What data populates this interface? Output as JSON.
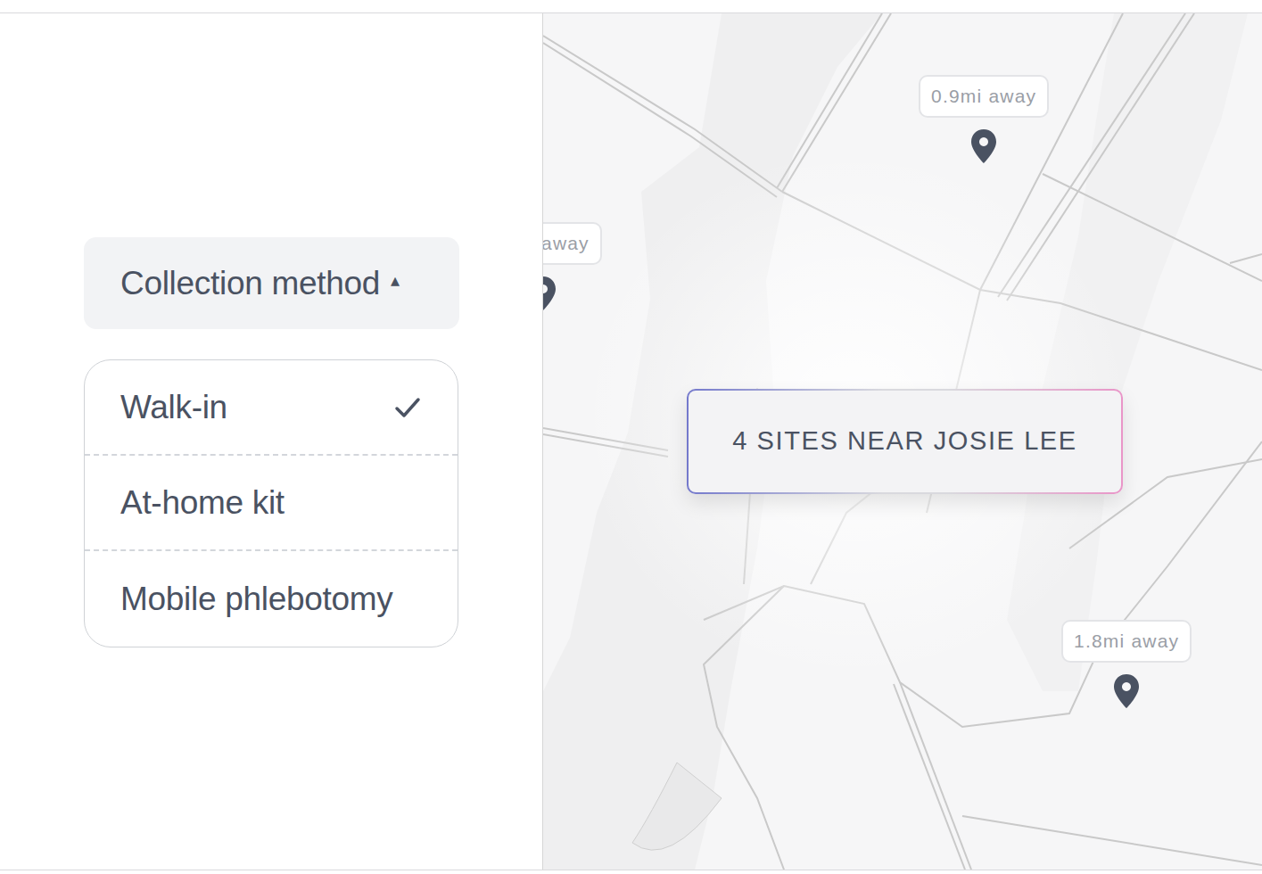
{
  "collection_method": {
    "label": "Collection method",
    "icon": "▴",
    "expanded": true,
    "options": [
      {
        "label": "Walk-in",
        "selected": true
      },
      {
        "label": "At-home kit",
        "selected": false
      },
      {
        "label": "Mobile phlebotomy",
        "selected": false
      }
    ]
  },
  "map": {
    "summary": "4 SITES NEAR JOSIE LEE",
    "pins": [
      {
        "label": "0.9mi away"
      },
      {
        "label": "away"
      },
      {
        "label": "1.8mi away"
      }
    ]
  }
}
